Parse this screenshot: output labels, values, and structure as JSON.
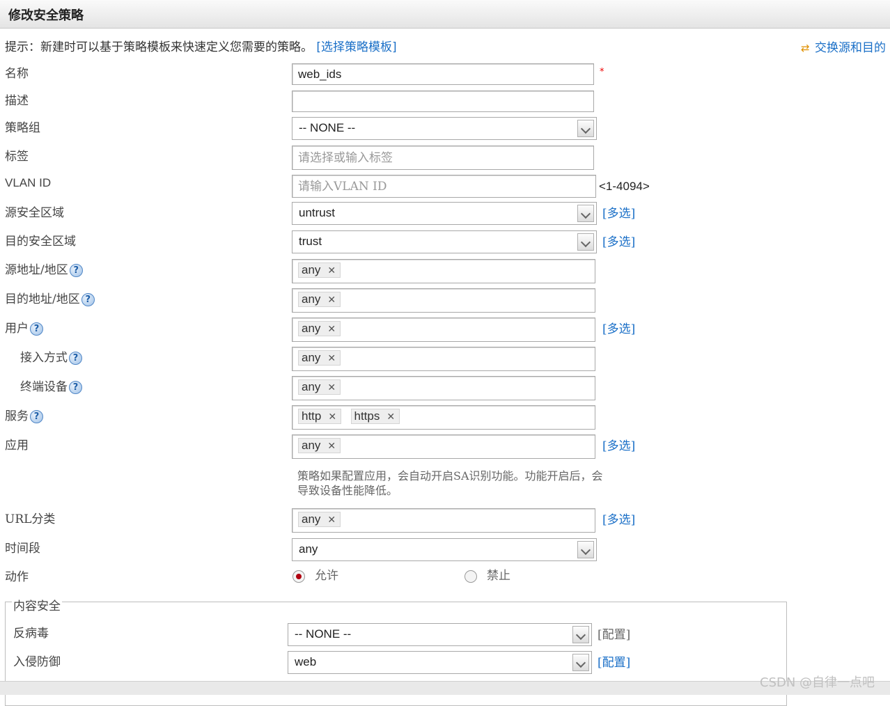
{
  "title": "修改安全策略",
  "hint": {
    "text": "提示：新建时可以基于策略模板来快速定义您需要的策略。",
    "link": "[选择策略模板]"
  },
  "swap_link": "交换源和目的",
  "form": {
    "name": {
      "label": "名称",
      "value": "web_ids",
      "required_mark": "*"
    },
    "description": {
      "label": "描述",
      "value": ""
    },
    "policy_group": {
      "label": "策略组",
      "value": "-- NONE --"
    },
    "tag": {
      "label": "标签",
      "placeholder": "请选择或输入标签"
    },
    "vlan": {
      "label": "VLAN ID",
      "placeholder": "请输入VLAN ID",
      "range": "<1-4094>"
    },
    "src_zone": {
      "label": "源安全区域",
      "value": "untrust",
      "multi": "[多选]"
    },
    "dst_zone": {
      "label": "目的安全区域",
      "value": "trust",
      "multi": "[多选]"
    },
    "src_addr": {
      "label": "源地址/地区",
      "tags": [
        "any"
      ]
    },
    "dst_addr": {
      "label": "目的地址/地区",
      "tags": [
        "any"
      ]
    },
    "user": {
      "label": "用户",
      "tags": [
        "any"
      ],
      "multi": "[多选]"
    },
    "access": {
      "label": "接入方式",
      "tags": [
        "any"
      ]
    },
    "device": {
      "label": "终端设备",
      "tags": [
        "any"
      ]
    },
    "service": {
      "label": "服务",
      "tags": [
        "http",
        "https"
      ]
    },
    "application": {
      "label": "应用",
      "tags": [
        "any"
      ],
      "multi": "[多选]",
      "note": "策略如果配置应用，会自动开启SA识别功能。功能开启后，会导致设备性能降低。"
    },
    "url": {
      "label": "URL分类",
      "tags": [
        "any"
      ],
      "multi": "[多选]"
    },
    "time": {
      "label": "时间段",
      "value": "any"
    },
    "action": {
      "label": "动作",
      "permit": "允许",
      "deny": "禁止"
    }
  },
  "content_security": {
    "legend": "内容安全",
    "antivirus": {
      "label": "反病毒",
      "value": "-- NONE --",
      "config": "[配置]"
    },
    "ips": {
      "label": "入侵防御",
      "value": "web",
      "config": "[配置]"
    }
  },
  "watermark": "CSDN @自律一点吧",
  "colors": {
    "link": "#1a6fc7",
    "required": "#e00000",
    "radio_selected": "#b00010"
  }
}
